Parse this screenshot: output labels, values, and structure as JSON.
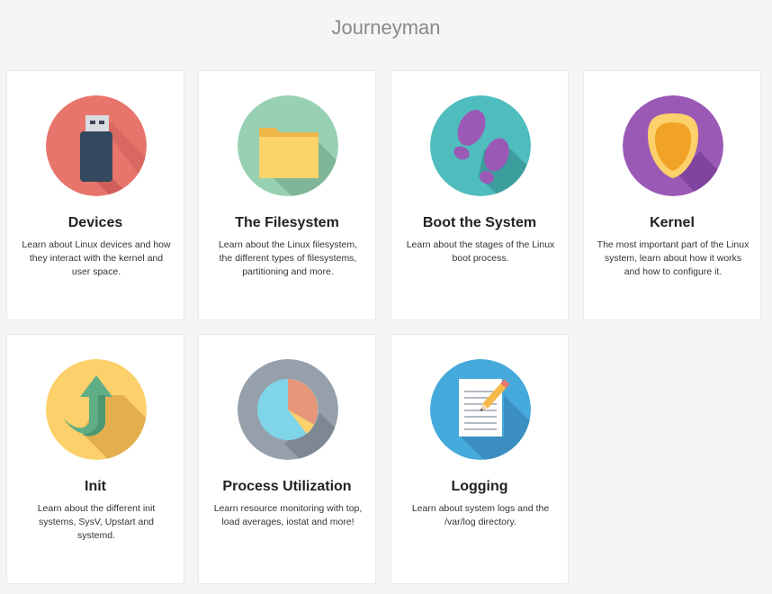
{
  "page": {
    "title": "Journeyman"
  },
  "cards": [
    {
      "title": "Devices",
      "description": "Learn about Linux devices and how they interact with the kernel and user space.",
      "icon": "usb-drive-icon",
      "color": "#e8756c"
    },
    {
      "title": "The Filesystem",
      "description": "Learn about the Linux filesystem, the different types of filesystems, partitioning and more.",
      "icon": "folder-icon",
      "color": "#98d0b4"
    },
    {
      "title": "Boot the System",
      "description": "Learn about the stages of the Linux boot process.",
      "icon": "footprints-icon",
      "color": "#4fbdbd"
    },
    {
      "title": "Kernel",
      "description": "The most important part of the Linux system, learn about how it works and how to configure it.",
      "icon": "kernel-seed-icon",
      "color": "#9b59b6"
    },
    {
      "title": "Init",
      "description": "Learn about the different init systems, SysV, Upstart and systemd.",
      "icon": "up-arrow-icon",
      "color": "#fcd06a"
    },
    {
      "title": "Process Utilization",
      "description": "Learn resource monitoring with top, load averages, iostat and more!",
      "icon": "pie-chart-icon",
      "color": "#95a0ab"
    },
    {
      "title": "Logging",
      "description": "Learn about system logs and the /var/log directory.",
      "icon": "notepad-pencil-icon",
      "color": "#45a9dc"
    }
  ]
}
